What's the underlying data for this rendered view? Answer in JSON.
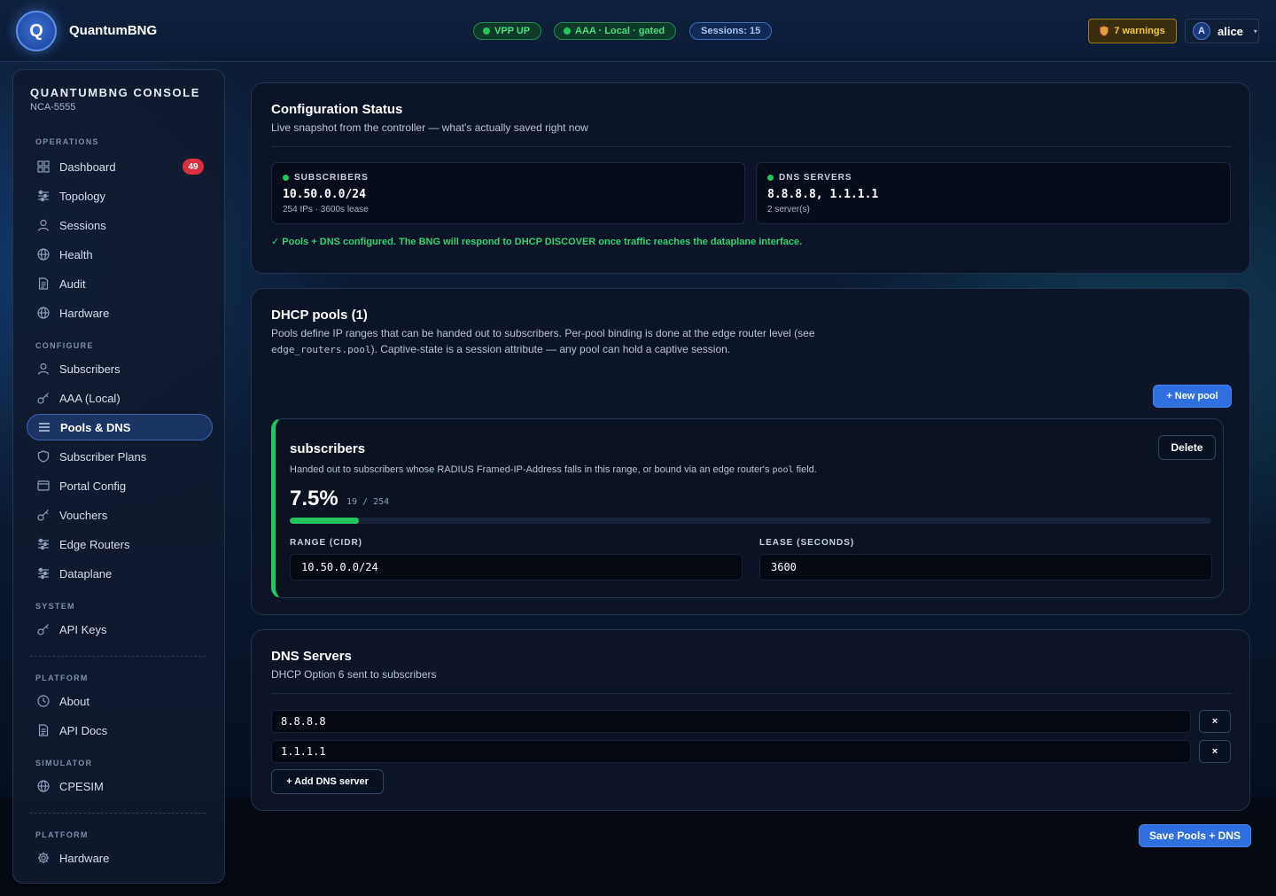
{
  "app": {
    "logo_letter": "Q",
    "brand": "QuantumBNG"
  },
  "status_pills": {
    "vpp": "VPP UP",
    "aaa": "AAA · Local · gated",
    "sessions": "Sessions: 15"
  },
  "warnings": {
    "label": "7 warnings",
    "icon": "shield-icon"
  },
  "user": {
    "initial": "A",
    "name": "alice"
  },
  "sidebar": {
    "title": "QUANTUMBNG CONSOLE",
    "subtitle": "NCA-5555",
    "sections": {
      "operations": "OPERATIONS",
      "configure": "CONFIGURE",
      "system": "SYSTEM",
      "platform": "PLATFORM",
      "simulator": "SIMULATOR",
      "platform2": "PLATFORM"
    },
    "items": {
      "dashboard": {
        "label": "Dashboard",
        "badge": "49",
        "icon": "grid-icon"
      },
      "topology": {
        "label": "Topology",
        "icon": "sliders-icon"
      },
      "sessions": {
        "label": "Sessions",
        "icon": "user-icon"
      },
      "health": {
        "label": "Health",
        "icon": "globe-icon"
      },
      "audit": {
        "label": "Audit",
        "icon": "document-icon"
      },
      "hardware": {
        "label": "Hardware",
        "icon": "globe-icon"
      },
      "subscribers": {
        "label": "Subscribers",
        "icon": "user-icon"
      },
      "aaa_local": {
        "label": "AAA (Local)",
        "icon": "key-icon"
      },
      "pools_dns": {
        "label": "Pools & DNS",
        "icon": "list-icon"
      },
      "subscriber_plans": {
        "label": "Subscriber Plans",
        "icon": "shield-icon"
      },
      "portal_config": {
        "label": "Portal Config",
        "icon": "window-icon"
      },
      "vouchers": {
        "label": "Vouchers",
        "icon": "key-icon"
      },
      "edge_routers": {
        "label": "Edge Routers",
        "icon": "sliders-icon"
      },
      "dataplane": {
        "label": "Dataplane",
        "icon": "sliders-icon"
      },
      "api_keys": {
        "label": "API Keys",
        "icon": "key-icon"
      },
      "about": {
        "label": "About",
        "icon": "clock-icon"
      },
      "api_docs": {
        "label": "API Docs",
        "icon": "document-icon"
      },
      "cpesim": {
        "label": "CPESIM",
        "icon": "globe-icon"
      },
      "hardware2": {
        "label": "Hardware",
        "icon": "gear-icon"
      }
    }
  },
  "config_status": {
    "title": "Configuration Status",
    "subtitle": "Live snapshot from the controller — what's actually saved right now",
    "subscribers": {
      "label": "SUBSCRIBERS",
      "value": "10.50.0.0/24",
      "meta": "254 IPs · 3600s lease"
    },
    "dns": {
      "label": "DNS SERVERS",
      "value": "8.8.8.8, 1.1.1.1",
      "meta": "2 server(s)"
    },
    "message": "✓ Pools + DNS configured. The BNG will respond to DHCP DISCOVER once traffic reaches the dataplane interface."
  },
  "dhcp_pools": {
    "title": "DHCP pools (1)",
    "desc_line1": "Pools define IP ranges that can be handed out to subscribers. Per-pool binding is done at the edge router level (see",
    "desc_code": "edge_routers.pool",
    "desc_line2_rest": "). Captive-state is a session attribute — any pool can hold a captive session.",
    "new_pool_label": "+ New pool",
    "pool": {
      "name": "subscribers",
      "delete_label": "Delete",
      "desc_prefix": "Handed out to subscribers whose RADIUS Framed-IP-Address falls in this range, or bound via an edge router's",
      "desc_code": "pool",
      "desc_suffix": "field.",
      "utilization_pct": "7.5%",
      "utilization_fraction": 0.075,
      "count": "19 / 254",
      "range_label": "RANGE (CIDR)",
      "range_value": "10.50.0.0/24",
      "lease_label": "LEASE (SECONDS)",
      "lease_value": "3600"
    }
  },
  "dns_servers": {
    "title": "DNS Servers",
    "subtitle": "DHCP Option 6 sent to subscribers",
    "servers": [
      "8.8.8.8",
      "1.1.1.1"
    ],
    "remove_label": "×",
    "add_label": "+ Add DNS server"
  },
  "save_label": "Save Pools + DNS",
  "colors": {
    "accent": "#2f6fe0",
    "ok": "#22c55e",
    "danger": "#dc2f3e",
    "warning": "#f5c84a"
  }
}
